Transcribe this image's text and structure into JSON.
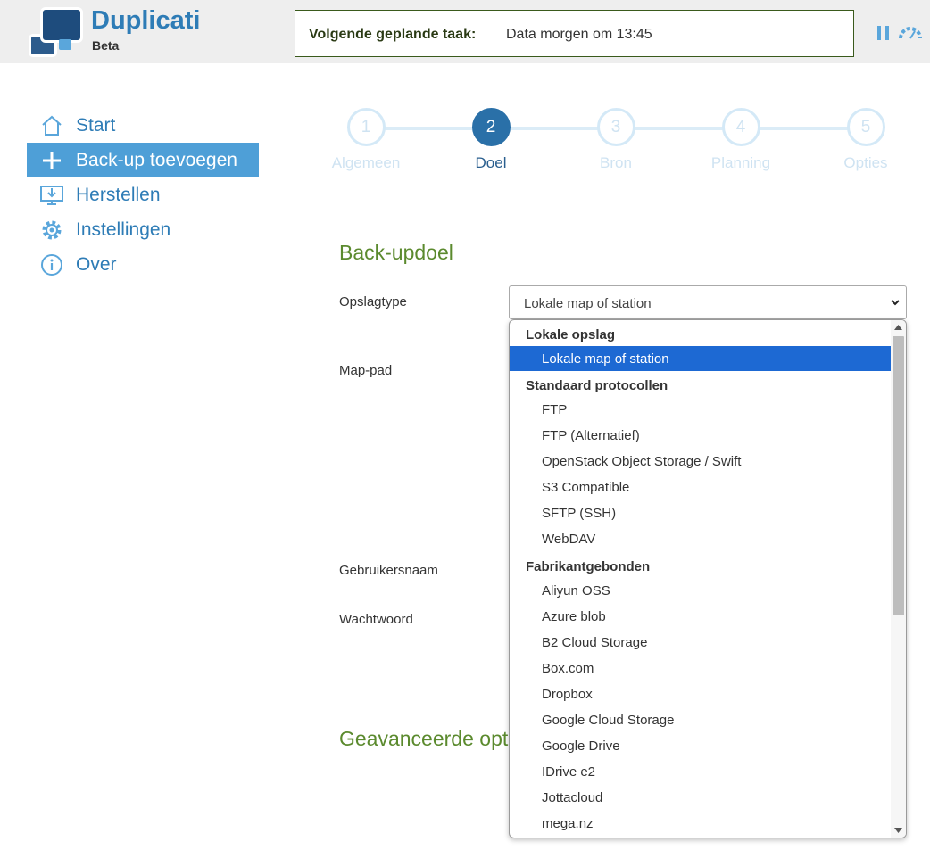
{
  "app": {
    "name": "Duplicati",
    "subtitle": "Beta"
  },
  "header": {
    "next_task_label": "Volgende geplande taak:",
    "next_task_value": "Data morgen om 13:45"
  },
  "sidebar": {
    "items": [
      {
        "label": "Start",
        "icon": "home-icon"
      },
      {
        "label": "Back-up toevoegen",
        "icon": "plus-icon",
        "active": true
      },
      {
        "label": "Herstellen",
        "icon": "restore-icon"
      },
      {
        "label": "Instellingen",
        "icon": "gear-icon"
      },
      {
        "label": "Over",
        "icon": "info-icon"
      }
    ]
  },
  "steps": [
    {
      "number": "1",
      "label": "Algemeen"
    },
    {
      "number": "2",
      "label": "Doel",
      "active": true
    },
    {
      "number": "3",
      "label": "Bron"
    },
    {
      "number": "4",
      "label": "Planning"
    },
    {
      "number": "5",
      "label": "Opties"
    }
  ],
  "form": {
    "section_title": "Back-updoel",
    "storage_type_label": "Opslagtype",
    "storage_type_value": "Lokale map of station",
    "folder_path_label": "Map-pad",
    "username_label": "Gebruikersnaam",
    "password_label": "Wachtwoord",
    "advanced_title": "Geavanceerde opt"
  },
  "dropdown": {
    "groups": [
      {
        "label": "Lokale opslag",
        "options": [
          "Lokale map of station"
        ]
      },
      {
        "label": "Standaard protocollen",
        "options": [
          "FTP",
          "FTP (Alternatief)",
          "OpenStack Object Storage / Swift",
          "S3 Compatible",
          "SFTP (SSH)",
          "WebDAV"
        ]
      },
      {
        "label": "Fabrikantgebonden",
        "options": [
          "Aliyun OSS",
          "Azure blob",
          "B2 Cloud Storage",
          "Box.com",
          "Dropbox",
          "Google Cloud Storage",
          "Google Drive",
          "IDrive e2",
          "Jottacloud",
          "mega.nz"
        ]
      }
    ],
    "selected": "Lokale map of station"
  },
  "colors": {
    "brand_blue": "#2e7cb6",
    "active_nav": "#4e9fd7",
    "section_green": "#5b8a2e",
    "dropdown_selected": "#1d69d3"
  }
}
